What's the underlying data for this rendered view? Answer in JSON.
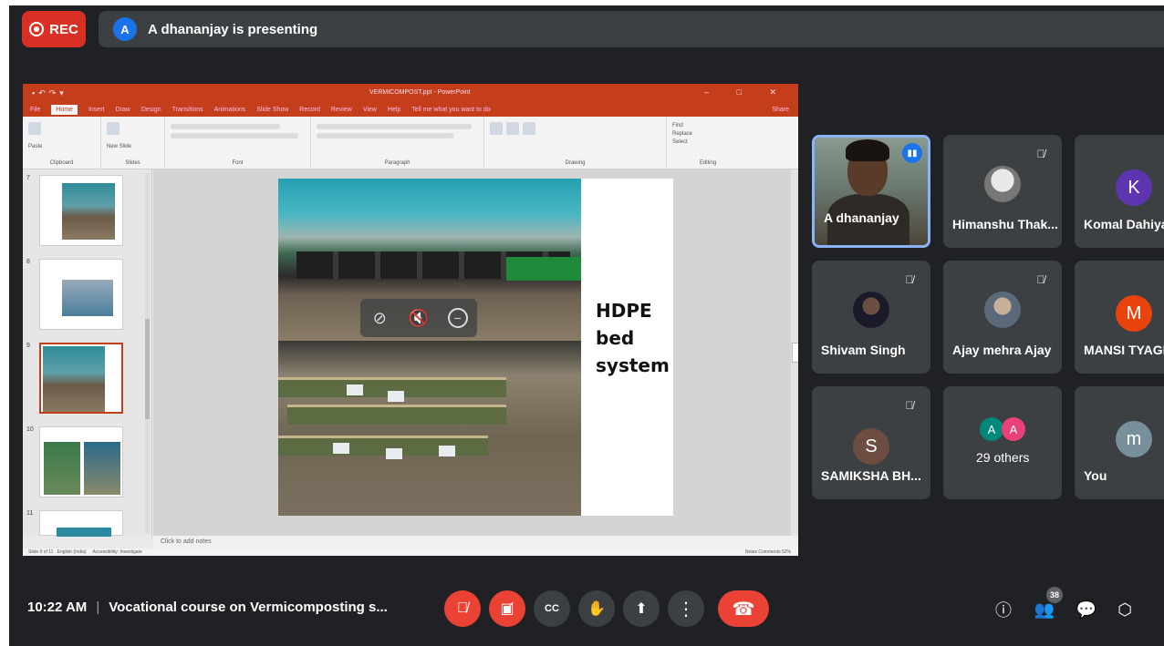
{
  "rec": {
    "label": "REC"
  },
  "presenting": {
    "avatar_letter": "A",
    "text": "A dhananjay is presenting"
  },
  "powerpoint": {
    "title": "VERMICOMPOST.ppt - PowerPoint",
    "tabs": [
      "File",
      "Home",
      "Insert",
      "Draw",
      "Design",
      "Transitions",
      "Animations",
      "Slide Show",
      "Record",
      "Review",
      "View",
      "Help",
      "Tell me what you want to do"
    ],
    "share": "Share",
    "groups": [
      "Clipboard",
      "Slides",
      "Font",
      "Paragraph",
      "Drawing",
      "Editing"
    ],
    "ribbon_texts": {
      "paste": "Paste",
      "new_slide": "New Slide",
      "find": "Find",
      "replace": "Replace",
      "select": "Select"
    },
    "thumb_numbers": [
      "7",
      "8",
      "9",
      "10",
      "11"
    ],
    "slide_caption": [
      "HDPE",
      "bed",
      "system"
    ],
    "notes_placeholder": "Click to add notes",
    "status_left": "Slide 9 of 11",
    "status_lang": "English (India)",
    "status_access": "Accessibility: Investigate",
    "status_right": "Notes   Comments      52%"
  },
  "overlay_icons": [
    "pin-off",
    "mute",
    "remove"
  ],
  "participants": [
    {
      "name": "A dhananjay",
      "speaking": true,
      "type": "camera"
    },
    {
      "name": "Himanshu Thak...",
      "type": "photo",
      "muted": true
    },
    {
      "name": "Komal Dahiya",
      "type": "letter",
      "letter": "K",
      "color": "#5e35b1"
    },
    {
      "name": "Shivam Singh",
      "type": "photo",
      "muted": true
    },
    {
      "name": "Ajay mehra Ajay",
      "type": "photo",
      "muted": true
    },
    {
      "name": "MANSI TYAGI",
      "type": "letter",
      "letter": "M",
      "color": "#e8430e"
    },
    {
      "name": "SAMIKSHA BH...",
      "type": "letter",
      "letter": "S",
      "color": "#6d4c41",
      "muted": true
    },
    {
      "name": "29 others",
      "type": "others",
      "letters": [
        "A",
        "A"
      ],
      "colors": [
        "#00897b",
        "#ec407a"
      ]
    },
    {
      "name": "You",
      "type": "letter",
      "letter": "m",
      "color": "#78909c"
    }
  ],
  "bottombar": {
    "time": "10:22 AM",
    "separator": "|",
    "meeting_title": "Vocational course on Vermicomposting s...",
    "participants_count": "38"
  }
}
